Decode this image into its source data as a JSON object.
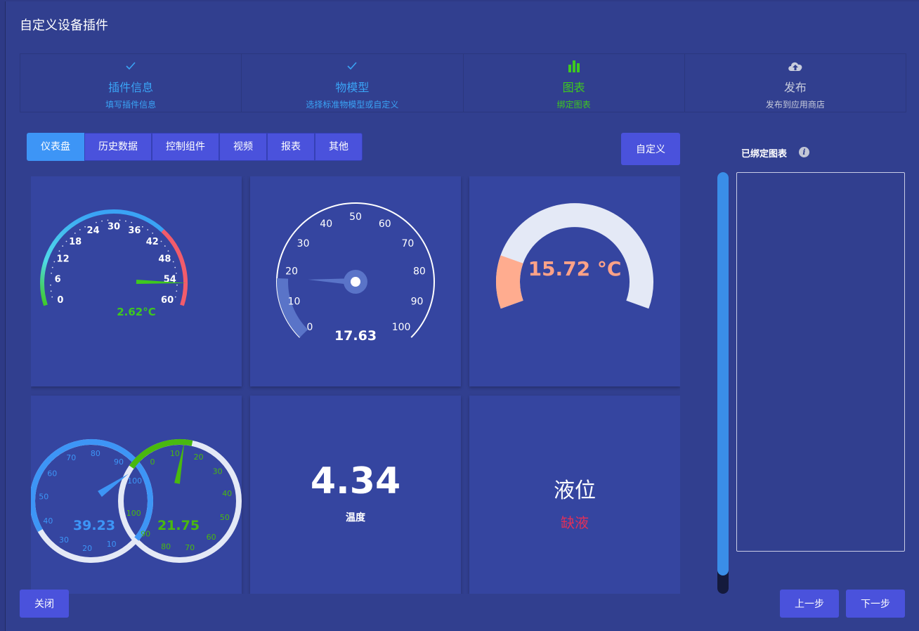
{
  "dialog": {
    "title": "自定义设备插件"
  },
  "steps": [
    {
      "title": "插件信息",
      "sub": "填写插件信息",
      "icon": "check-icon",
      "state": "done"
    },
    {
      "title": "物模型",
      "sub": "选择标准物模型或自定义",
      "icon": "check-icon",
      "state": "done"
    },
    {
      "title": "图表",
      "sub": "绑定图表",
      "icon": "bar-chart-icon",
      "state": "active"
    },
    {
      "title": "发布",
      "sub": "发布到应用商店",
      "icon": "cloud-upload-icon",
      "state": "wait"
    }
  ],
  "tabs": [
    "仪表盘",
    "历史数据",
    "控制组件",
    "视频",
    "报表",
    "其他"
  ],
  "active_tab": 0,
  "custom_button": "自定义",
  "widgets": {
    "gauge1": {
      "value_label": "2.62°C",
      "ticks": [
        "0",
        "6",
        "12",
        "18",
        "24",
        "30",
        "36",
        "42",
        "48",
        "54",
        "60"
      ],
      "value": 2.62,
      "min": 0,
      "max": 60
    },
    "gauge2": {
      "value_label": "17.63",
      "ticks": [
        "0",
        "10",
        "20",
        "30",
        "40",
        "50",
        "60",
        "70",
        "80",
        "90",
        "100"
      ],
      "value": 17.63,
      "min": 0,
      "max": 100
    },
    "gauge3": {
      "value_label": "15.72 °C",
      "fraction": 0.18
    },
    "gauge4": {
      "left": {
        "value_label": "39.23",
        "ticks": [
          "10",
          "20",
          "30",
          "40",
          "50",
          "60",
          "70",
          "80",
          "90",
          "100"
        ],
        "value": 39.23
      },
      "right": {
        "value_label": "21.75",
        "ticks": [
          "0",
          "10",
          "20",
          "30",
          "40",
          "50",
          "60",
          "70",
          "80",
          "90",
          "100"
        ],
        "value": 21.75
      }
    },
    "number": {
      "value": "4.34",
      "label": "温度"
    },
    "level": {
      "title": "液位",
      "status": "缺液"
    }
  },
  "bound": {
    "title": "已绑定图表",
    "info": "i"
  },
  "footer": {
    "close": "关闭",
    "prev": "上一步",
    "next": "下一步"
  },
  "colors": {
    "accent": "#4a52dc",
    "active_tab": "#3d95f6",
    "success": "#3ec91e",
    "danger": "#e0305a"
  }
}
